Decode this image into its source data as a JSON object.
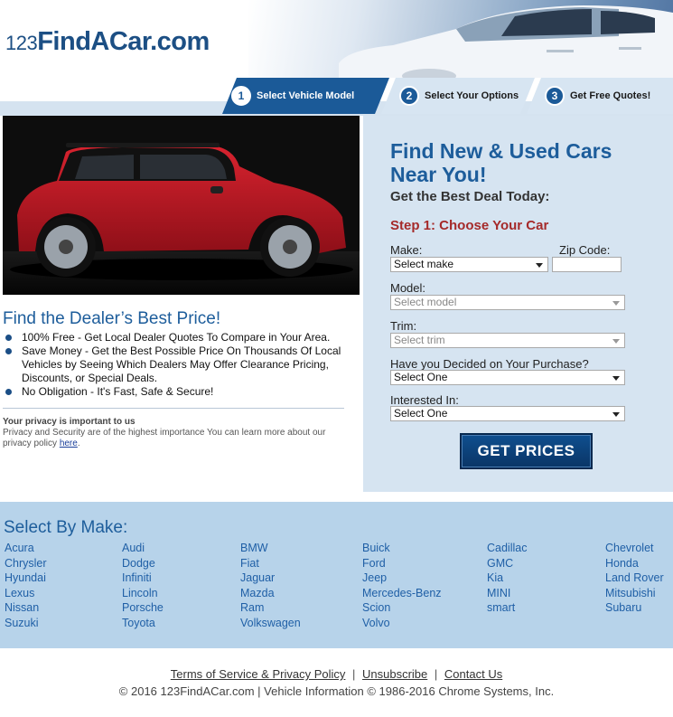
{
  "header": {
    "logo_num": "123",
    "logo_text": "FindACar.com"
  },
  "steps": [
    {
      "num": "1",
      "label": "Select Vehicle Model"
    },
    {
      "num": "2",
      "label": "Select Your Options"
    },
    {
      "num": "3",
      "label": "Get Free Quotes!"
    }
  ],
  "left": {
    "title": "Find the Dealer’s Best Price!",
    "features": [
      "100% Free - Get Local Dealer Quotes To Compare in Your Area.",
      "Save Money - Get the Best Possible Price On Thousands Of Local Vehicles by Seeing Which Dealers May Offer Clearance Pricing, Discounts, or Special Deals.",
      "No Obligation - It's Fast, Safe & Secure!"
    ],
    "privacy_head": "Your privacy is important to us",
    "privacy_body": "Privacy and Security are of the highest importance You can learn more about our privacy policy ",
    "privacy_link": "here",
    "privacy_end": "."
  },
  "form": {
    "title": "Find New & Used Cars Near You!",
    "subtitle": "Get the Best Deal Today:",
    "step_title": "Step 1: Choose Your Car",
    "make_label": "Make:",
    "make_value": "Select make",
    "zip_label": "Zip Code:",
    "zip_value": "",
    "model_label": "Model:",
    "model_value": "Select model",
    "trim_label": "Trim:",
    "trim_value": "Select trim",
    "decided_label": "Have you Decided on Your Purchase?",
    "decided_value": "Select One",
    "interested_label": "Interested In:",
    "interested_value": "Select One",
    "button": "GET PRICES"
  },
  "makes": {
    "title": "Select By Make:",
    "columns": [
      [
        "Acura",
        "Chrysler",
        "Hyundai",
        "Lexus",
        "Nissan",
        "Suzuki"
      ],
      [
        "Audi",
        "Dodge",
        "Infiniti",
        "Lincoln",
        "Porsche",
        "Toyota"
      ],
      [
        "BMW",
        "Fiat",
        "Jaguar",
        "Mazda",
        "Ram",
        "Volkswagen"
      ],
      [
        "Buick",
        "Ford",
        "Jeep",
        "Mercedes-Benz",
        "Scion",
        "Volvo"
      ],
      [
        "Cadillac",
        "GMC",
        "Kia",
        "MINI",
        "smart"
      ],
      [
        "Chevrolet",
        "Honda",
        "Land Rover",
        "Mitsubishi",
        "Subaru"
      ]
    ]
  },
  "footer": {
    "terms": "Terms of Service & Privacy Policy",
    "unsubscribe": "Unsubscribe",
    "contact": "Contact Us",
    "separator": "|",
    "copyright": "© 2016 123FindACar.com | Vehicle Information © 1986-2016 Chrome Systems, Inc."
  },
  "colors": {
    "brand_blue": "#1d5d9b",
    "step_red": "#a52a2a",
    "form_bg": "#d6e4f1",
    "makes_bg": "#b7d3ea",
    "button_bg": "#0f4f8f"
  }
}
